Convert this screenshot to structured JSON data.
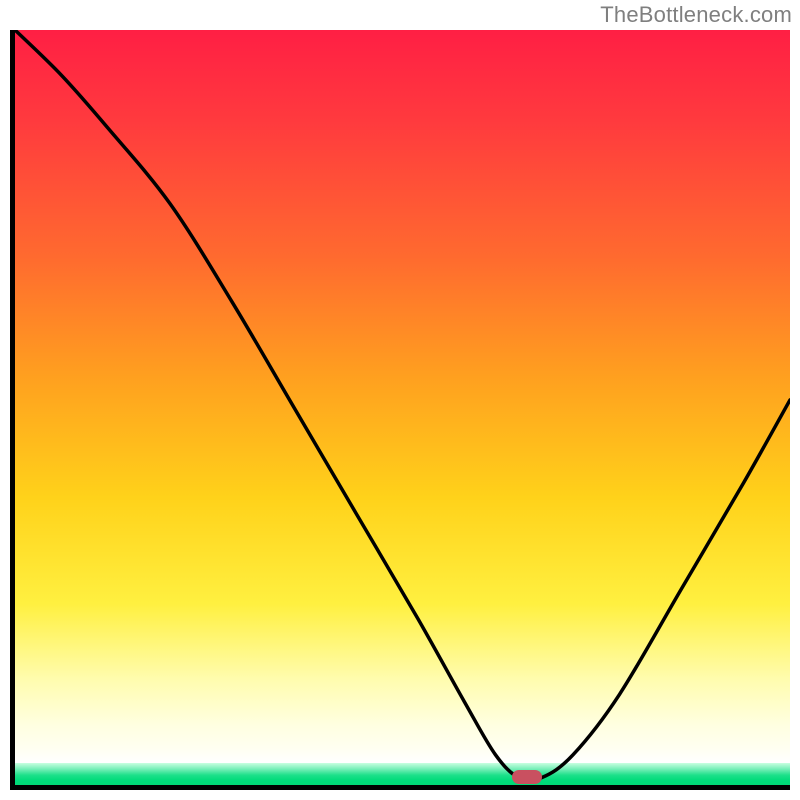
{
  "watermark": "TheBottleneck.com",
  "chart_data": {
    "type": "line",
    "title": "",
    "xlabel": "",
    "ylabel": "",
    "xlim": [
      0,
      100
    ],
    "ylim": [
      0,
      100
    ],
    "grid": false,
    "legend": false,
    "background_gradient": {
      "direction": "vertical",
      "stops": [
        {
          "pos": 0.0,
          "color": "#ff1f44"
        },
        {
          "pos": 0.3,
          "color": "#ff6a2f"
        },
        {
          "pos": 0.62,
          "color": "#ffd21a"
        },
        {
          "pos": 0.86,
          "color": "#fffcae"
        },
        {
          "pos": 0.97,
          "color": "#c8ffe0"
        },
        {
          "pos": 1.0,
          "color": "#00d876"
        }
      ]
    },
    "series": [
      {
        "name": "bottleneck-curve",
        "color": "#000000",
        "x": [
          0,
          6,
          12,
          20,
          28,
          36,
          44,
          52,
          58,
          62,
          65,
          68,
          72,
          78,
          86,
          94,
          100
        ],
        "y": [
          100,
          94,
          87,
          77,
          64,
          50,
          36,
          22,
          11,
          4,
          1,
          1,
          4,
          12,
          26,
          40,
          51
        ]
      }
    ],
    "marker": {
      "name": "optimal-point",
      "x": 66,
      "y": 1,
      "color": "#c95060",
      "shape": "rounded-rect"
    }
  }
}
